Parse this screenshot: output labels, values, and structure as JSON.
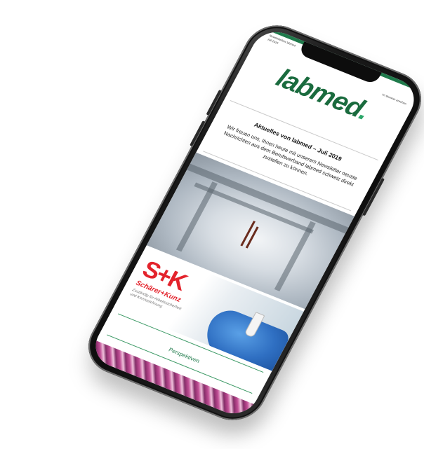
{
  "status_bar": {
    "preview_text": "Newsletterbox labmed",
    "date": "Juli 2019",
    "browser_link": "Im Browser ansehen"
  },
  "newsletter": {
    "logo_text": "labmed",
    "logo_dot": ".",
    "headline": "Aktuelles von labmed – Juli 2019",
    "intro": "Wir freuen uns, Ihnen heute mit unserem Newsletter neuste Nachrichten aus dem Berufsverband labmed schweiz direkt zustellen zu können."
  },
  "advertisement": {
    "logo": "S+K",
    "company": "Schärer+Kunz",
    "tagline": "Zuständig für Arbeitssicherheit und Kennzeichnung"
  },
  "footer": {
    "link_label": "Perspektiven"
  },
  "colors": {
    "brand_green": "#1a6b3e",
    "accent_green": "#2aa568",
    "ad_red": "#e3232c",
    "footer_pattern": "#8a2d6b"
  }
}
